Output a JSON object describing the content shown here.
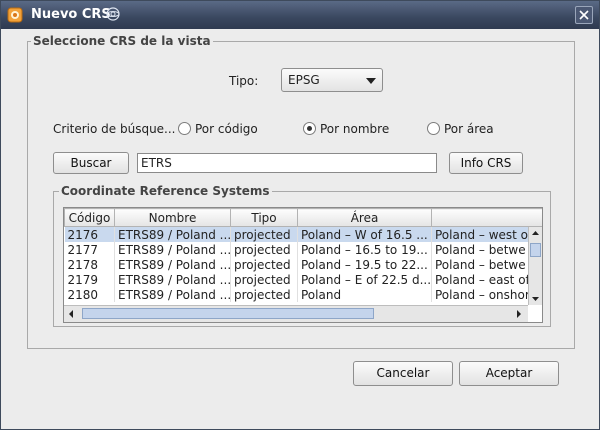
{
  "window": {
    "title": "Nuevo CRS",
    "close_label": "×"
  },
  "group_main": {
    "label": "Seleccione CRS de la vista"
  },
  "tipo": {
    "label": "Tipo:",
    "value": "EPSG"
  },
  "criterio": {
    "label": "Criterio de búsque...",
    "options": [
      {
        "label": "Por código",
        "selected": false
      },
      {
        "label": "Por nombre",
        "selected": true
      },
      {
        "label": "Por área",
        "selected": false
      }
    ]
  },
  "search": {
    "button_label": "Buscar",
    "query": "ETRS",
    "info_button_label": "Info CRS"
  },
  "crs_group": {
    "label": "Coordinate Reference Systems"
  },
  "table": {
    "headers": [
      "Código",
      "Nombre",
      "Tipo",
      "Área",
      ""
    ],
    "rows": [
      [
        "2176",
        "ETRS89 / Poland ...",
        "projected",
        "Poland – W of 16.5 ...",
        "Poland – west o"
      ],
      [
        "2177",
        "ETRS89 / Poland ...",
        "projected",
        "Poland – 16.5 to 19...",
        "Poland – betwe"
      ],
      [
        "2178",
        "ETRS89 / Poland ...",
        "projected",
        "Poland – 19.5 to 22...",
        "Poland – betwe"
      ],
      [
        "2179",
        "ETRS89 / Poland ...",
        "projected",
        "Poland – E of 22.5 d...",
        "Poland – east of"
      ],
      [
        "2180",
        "ETRS89 / Poland ...",
        "projected",
        "Poland",
        "Poland – onshor"
      ]
    ],
    "selected_row": 0
  },
  "footer": {
    "cancel_label": "Cancelar",
    "accept_label": "Aceptar"
  },
  "colors": {
    "title_bar": "#3a475f",
    "selection": "#c9d9ee",
    "scroll_thumb": "#c4d4ec"
  }
}
